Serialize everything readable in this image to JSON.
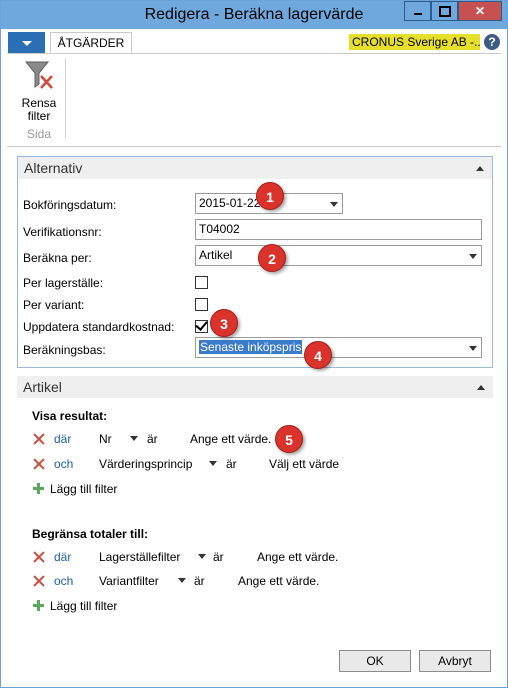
{
  "window": {
    "title": "Redigera - Beräkna lagervärde"
  },
  "ribbon": {
    "tab_label": "ÅTGÄRDER",
    "company": "CRONUS Sverige AB -...",
    "help_label": "?",
    "rensa_line1": "Rensa",
    "rensa_line2": "filter",
    "group_label": "Sida"
  },
  "alternativ": {
    "title": "Alternativ",
    "fields": {
      "bokforingsdatum": {
        "label": "Bokföringsdatum:",
        "value": "2015-01-22"
      },
      "verifikationsnr": {
        "label": "Verifikationsnr:",
        "value": "T04002"
      },
      "berakna_per": {
        "label": "Beräkna per:",
        "value": "Artikel"
      },
      "per_lagerstalle": {
        "label": "Per lagerställe:",
        "checked": false
      },
      "per_variant": {
        "label": "Per variant:",
        "checked": false
      },
      "uppdatera": {
        "label": "Uppdatera standardkostnad:",
        "checked": true
      },
      "berakningsbas": {
        "label": "Beräkningsbas:",
        "value": "Senaste inköpspris"
      }
    }
  },
  "artikel": {
    "title": "Artikel",
    "visa_resultat": {
      "heading": "Visa resultat:",
      "filters": [
        {
          "connector": "där",
          "field": "Nr",
          "op": "är",
          "value": "Ange ett värde."
        },
        {
          "connector": "och",
          "field": "Värderingsprincip",
          "op": "är",
          "value": "Välj ett värde"
        }
      ],
      "add_label": "Lägg till filter"
    },
    "begransa": {
      "heading": "Begränsa totaler till:",
      "filters": [
        {
          "connector": "där",
          "field": "Lagerställefilter",
          "op": "är",
          "value": "Ange ett värde."
        },
        {
          "connector": "och",
          "field": "Variantfilter",
          "op": "är",
          "value": "Ange ett värde."
        }
      ],
      "add_label": "Lägg till filter"
    }
  },
  "badges": [
    "1",
    "2",
    "3",
    "4",
    "5"
  ],
  "buttons": {
    "ok": "OK",
    "cancel": "Avbryt"
  }
}
